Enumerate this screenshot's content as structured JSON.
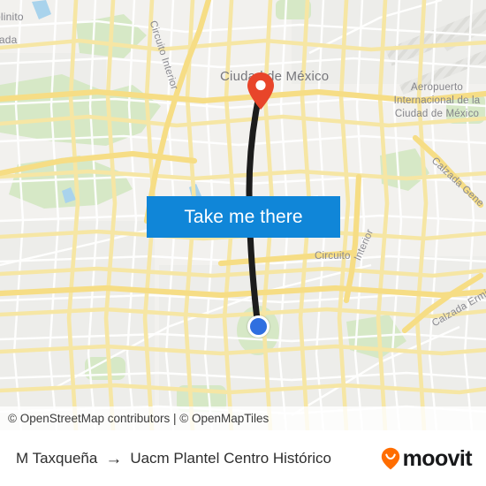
{
  "map": {
    "attribution": "© OpenStreetMap contributors | © OpenMapTiles",
    "labels": {
      "city": "Ciudad de México",
      "place_molinito": "olinito",
      "place_nada": "ñada",
      "airport": "Aeropuerto Internacional de la Ciudad de México",
      "road_circuito_interior_top": "Circuito Interior",
      "road_circuito": "Circuito",
      "road_interior": "Interior",
      "road_calzada_gene": "Calzada Gene",
      "road_calzada_ermita": "Calzada Ermita"
    },
    "markers": {
      "origin_name": "M Taxqueña",
      "origin_color": "#2f6fe0",
      "destination_name": "Uacm Plantel Centro Histórico",
      "destination_color": "#e8452a"
    },
    "route_color": "#1c1c1c"
  },
  "cta": {
    "label": "Take me there",
    "background": "#1086d8",
    "text_color": "#ffffff"
  },
  "bottom_bar": {
    "origin": "M Taxqueña",
    "arrow": "→",
    "destination": "Uacm Plantel Centro Histórico",
    "brand": "moovit",
    "brand_pin_color": "#ff6d00"
  }
}
